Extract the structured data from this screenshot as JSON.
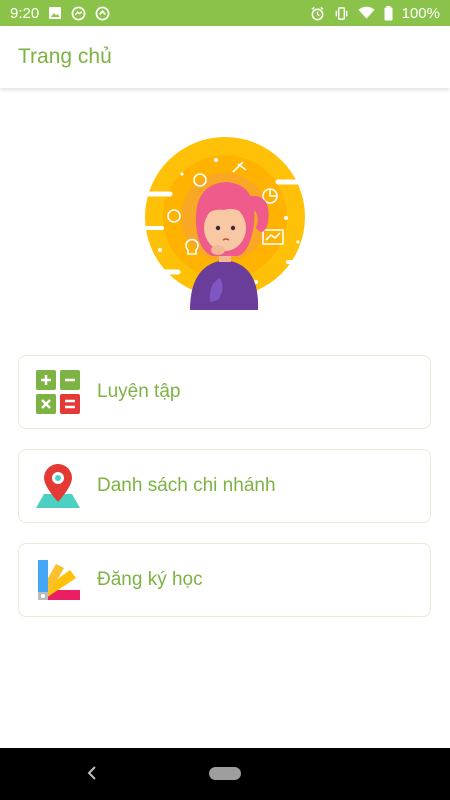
{
  "status_bar": {
    "time": "9:20",
    "battery": "100%",
    "background": "#8bc34a",
    "left_icons": [
      "image-icon",
      "messenger-icon",
      "sync-icon"
    ],
    "right_icons": [
      "alarm-icon",
      "vibrate-icon",
      "wifi-icon",
      "battery-icon"
    ]
  },
  "app_bar": {
    "title": "Trang chủ",
    "accent": "#7cb342"
  },
  "hero": {
    "image": "girl-thinking-illustration",
    "colors": [
      "#ffc107",
      "#f7a21b",
      "#6a3d9a"
    ]
  },
  "menu": {
    "items": [
      {
        "label": "Luyện tập",
        "icon": "calculator-icon"
      },
      {
        "label": "Danh sách chi nhánh",
        "icon": "map-pin-icon"
      },
      {
        "label": "Đăng ký học",
        "icon": "color-swatch-icon"
      }
    ]
  },
  "nav_bar": {
    "buttons": [
      "back-icon",
      "home-pill"
    ]
  }
}
